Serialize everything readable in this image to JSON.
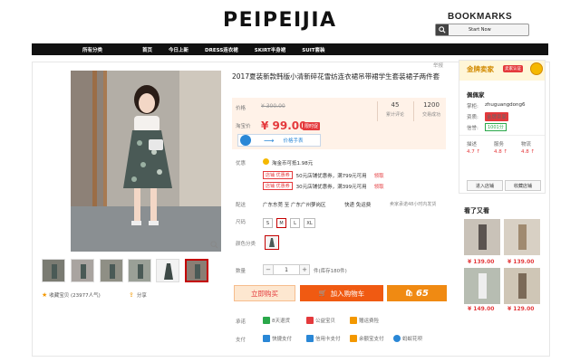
{
  "header": {
    "logo": "PEIPEIJIA",
    "bookmarks_title": "BOOKMARKS",
    "bookmarks_button": "Start Now"
  },
  "nav": {
    "items": [
      "所有分类",
      "首页",
      "今日上新",
      "DRESS连衣裙",
      "SKIRT半身裙",
      "SUIT套装"
    ]
  },
  "product": {
    "title": "2017夏装新款韩版小清新碎花雪纺连衣裙吊带裙学生套装裙子两件套",
    "report": "举报",
    "price_label": "价格",
    "original_price": "¥ 300.00",
    "promo_label": "淘宝价",
    "promo_price": "¥ 99.00",
    "promo_tag": "限时促",
    "stats": [
      {
        "value": "45",
        "label": "累计评论"
      },
      {
        "value": "1200",
        "label": "交易成功"
      }
    ],
    "trend_label": "价格手表",
    "coupon_section_label": "优惠",
    "taobao_coupon": "淘金币可抵1.98元",
    "coupons": [
      {
        "tag": "店铺 优惠券",
        "text": "50元店铺优惠券，满799元可用",
        "action": "领取"
      },
      {
        "tag": "店铺 优惠券",
        "text": "30元店铺优惠券，满399元可用",
        "action": "领取"
      }
    ],
    "shipping_label": "配送",
    "ship_from": "广东东莞 至 广东广州萝岗区",
    "ship_fee": "快递 免运费",
    "ship_promise": "卖家承诺48小时内发货",
    "size_label": "尺码",
    "sizes": [
      "S",
      "M",
      "L",
      "XL"
    ],
    "selected_size": "M",
    "color_label": "颜色分类",
    "quantity_label": "数量",
    "quantity": "1",
    "stock": "件(库存180件)",
    "buy_button": "立即购买",
    "cart_button": "加入购物车",
    "coupon_button": "65",
    "favorite_label": "收藏宝贝 (23977人气)",
    "share_label": "分享",
    "promise_label": "承诺",
    "promises": [
      "8天退货",
      "公益宝贝",
      "赠运费险"
    ],
    "payment_label": "支付",
    "payments": [
      "快捷支付",
      "信用卡支付",
      "余额宝支付",
      "蚂蚁花呗"
    ]
  },
  "shop": {
    "banner": "金牌卖家",
    "banner_badge": "卖家认证",
    "name": "佩佩家",
    "owner_label": "掌柜:",
    "owner": "zhuguangdong6",
    "qualify_label": "资质:",
    "qualify_badge": "金牌卖家",
    "credit_label": "信誉:",
    "credit_badge": "1001分",
    "ratings": [
      {
        "label": "描述",
        "value": "4.7 ↑"
      },
      {
        "label": "服务",
        "value": "4.8 ↑"
      },
      {
        "label": "物流",
        "value": "4.8 ↑"
      }
    ],
    "enter_shop": "进入店铺",
    "fav_shop": "收藏店铺"
  },
  "recommend": {
    "title": "看了又看",
    "more": "",
    "items": [
      {
        "price": "¥ 139.00"
      },
      {
        "price": "¥ 139.00"
      },
      {
        "price": "¥ 149.00"
      },
      {
        "price": "¥ 129.00"
      }
    ]
  },
  "colors": {
    "accent_red": "#e4393c",
    "cart_orange": "#f05a12",
    "price_bg": "#fff2e8"
  }
}
